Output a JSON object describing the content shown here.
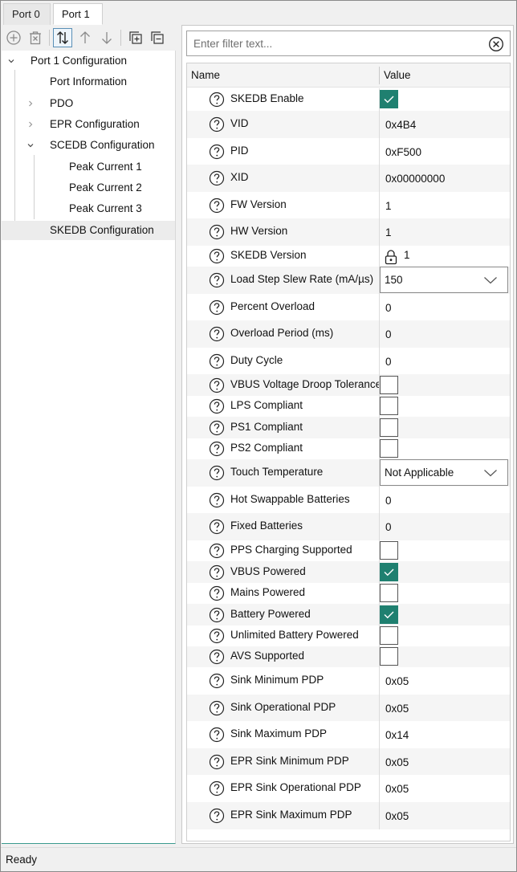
{
  "tabs": [
    {
      "label": "Port 0",
      "active": false
    },
    {
      "label": "Port 1",
      "active": true
    }
  ],
  "toolbar": {
    "buttons": [
      "add-icon",
      "delete-icon",
      "swap-order-icon",
      "move-up-icon",
      "move-down-icon",
      "expand-all-icon",
      "collapse-all-icon"
    ]
  },
  "tree": {
    "items": [
      {
        "label": "Port 1 Configuration",
        "chevron": "down"
      },
      {
        "label": "Port Information",
        "chevron": "none"
      },
      {
        "label": "PDO",
        "chevron": "right"
      },
      {
        "label": "EPR Configuration",
        "chevron": "right"
      },
      {
        "label": "SCEDB Configuration",
        "chevron": "down"
      },
      {
        "label": "Peak Current 1",
        "chevron": "none"
      },
      {
        "label": "Peak Current 2",
        "chevron": "none"
      },
      {
        "label": "Peak Current 3",
        "chevron": "none"
      },
      {
        "label": "SKEDB Configuration",
        "chevron": "none",
        "selected": true
      }
    ]
  },
  "filter": {
    "placeholder": "Enter filter text..."
  },
  "grid": {
    "header": {
      "name": "Name",
      "value": "Value"
    },
    "rows": [
      {
        "name": "SKEDB Enable",
        "type": "checkbox",
        "checked": true
      },
      {
        "name": "VID",
        "type": "text",
        "value": "0x4B4"
      },
      {
        "name": "PID",
        "type": "text",
        "value": "0xF500"
      },
      {
        "name": "XID",
        "type": "text",
        "value": "0x00000000"
      },
      {
        "name": "FW Version",
        "type": "text",
        "value": "1"
      },
      {
        "name": "HW Version",
        "type": "text",
        "value": "1"
      },
      {
        "name": "SKEDB Version",
        "type": "locked",
        "value": "1"
      },
      {
        "name": "Load Step Slew Rate (mA/µs)",
        "type": "dropdown",
        "value": "150"
      },
      {
        "name": "Percent Overload",
        "type": "text",
        "value": "0"
      },
      {
        "name": "Overload Period (ms)",
        "type": "text",
        "value": "0"
      },
      {
        "name": "Duty Cycle",
        "type": "text",
        "value": "0"
      },
      {
        "name": "VBUS Voltage Droop Tolerance",
        "type": "checkbox",
        "checked": false
      },
      {
        "name": "LPS Compliant",
        "type": "checkbox",
        "checked": false
      },
      {
        "name": "PS1 Compliant",
        "type": "checkbox",
        "checked": false
      },
      {
        "name": "PS2 Compliant",
        "type": "checkbox",
        "checked": false
      },
      {
        "name": "Touch Temperature",
        "type": "dropdown",
        "value": "Not Applicable"
      },
      {
        "name": "Hot Swappable Batteries",
        "type": "text",
        "value": "0"
      },
      {
        "name": "Fixed Batteries",
        "type": "text",
        "value": "0"
      },
      {
        "name": "PPS Charging Supported",
        "type": "checkbox",
        "checked": false
      },
      {
        "name": "VBUS Powered",
        "type": "checkbox",
        "checked": true
      },
      {
        "name": "Mains Powered",
        "type": "checkbox",
        "checked": false
      },
      {
        "name": "Battery Powered",
        "type": "checkbox",
        "checked": true
      },
      {
        "name": "Unlimited Battery Powered",
        "type": "checkbox",
        "checked": false
      },
      {
        "name": "AVS Supported",
        "type": "checkbox",
        "checked": false
      },
      {
        "name": "Sink Minimum PDP",
        "type": "text",
        "value": "0x05"
      },
      {
        "name": "Sink Operational PDP",
        "type": "text",
        "value": "0x05"
      },
      {
        "name": "Sink Maximum PDP",
        "type": "text",
        "value": "0x14"
      },
      {
        "name": "EPR Sink Minimum PDP",
        "type": "text",
        "value": "0x05"
      },
      {
        "name": "EPR Sink Operational PDP",
        "type": "text",
        "value": "0x05"
      },
      {
        "name": "EPR Sink Maximum PDP",
        "type": "text",
        "value": "0x05"
      }
    ]
  },
  "status": {
    "text": "Ready"
  },
  "colors": {
    "accent": "#1f8070",
    "tree_border": "#3a9a8e"
  }
}
